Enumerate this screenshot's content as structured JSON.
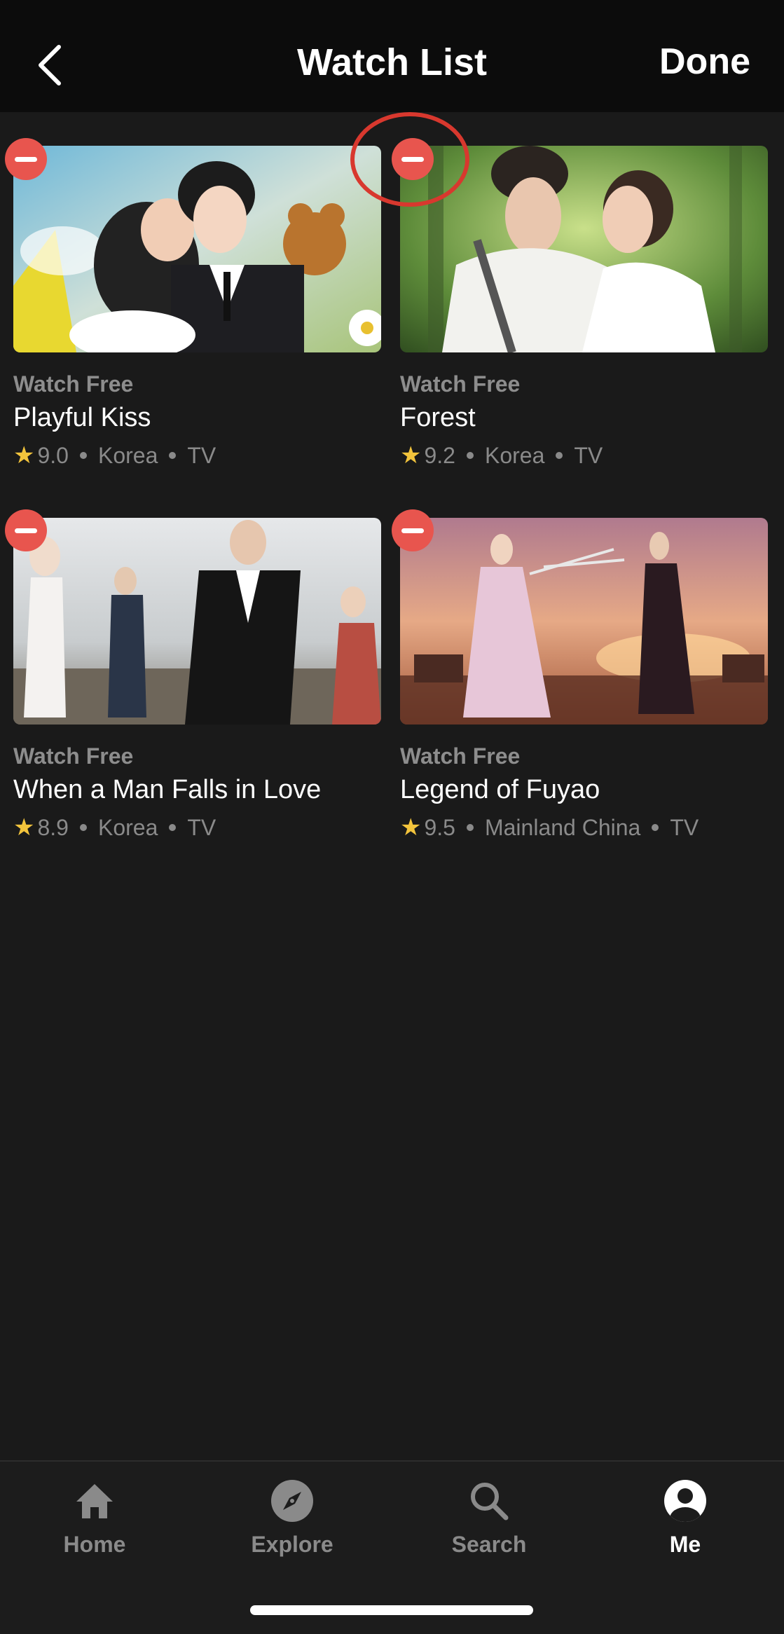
{
  "header": {
    "title": "Watch List",
    "done_label": "Done",
    "back_icon": "chevron-left-icon"
  },
  "items": [
    {
      "badge": "Watch Free",
      "title": "Playful Kiss",
      "rating": "9.0",
      "region": "Korea",
      "type": "TV"
    },
    {
      "badge": "Watch Free",
      "title": "Forest",
      "rating": "9.2",
      "region": "Korea",
      "type": "TV"
    },
    {
      "badge": "Watch Free",
      "title": "When a Man Falls in Love",
      "rating": "8.9",
      "region": "Korea",
      "type": "TV"
    },
    {
      "badge": "Watch Free",
      "title": "Legend of Fuyao",
      "rating": "9.5",
      "region": "Mainland China",
      "type": "TV"
    }
  ],
  "tabs": [
    {
      "label": "Home",
      "icon": "home-icon",
      "active": false
    },
    {
      "label": "Explore",
      "icon": "compass-icon",
      "active": false
    },
    {
      "label": "Search",
      "icon": "search-icon",
      "active": false
    },
    {
      "label": "Me",
      "icon": "profile-icon",
      "active": true
    }
  ],
  "colors": {
    "background": "#1a1a1a",
    "header": "#0c0c0c",
    "remove": "#e8554e",
    "highlight": "#d8382e",
    "star": "#f3c43c",
    "muted": "#8a8a8a"
  }
}
